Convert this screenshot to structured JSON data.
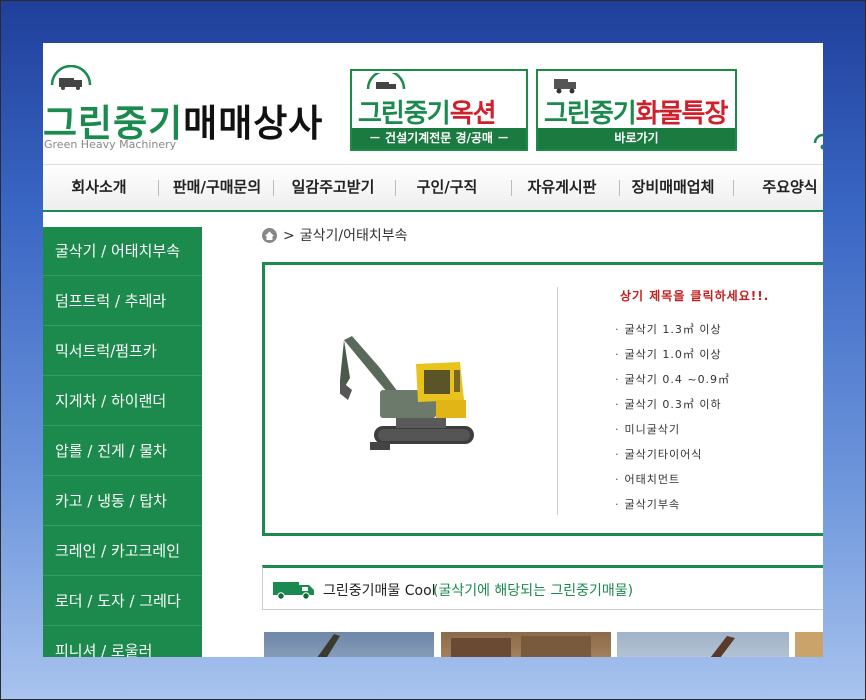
{
  "site": {
    "logo_part1": "그린중기",
    "logo_part2": "매매상사",
    "logo_subtitle": "Green Heavy Machinery"
  },
  "banners": {
    "auction": {
      "title_green": "그린중기",
      "title_red": "옥션",
      "bar_text": "－ 건설기계전문 경/공매 －"
    },
    "truck": {
      "title_green": "그린중기",
      "title_red": "화물특장",
      "bar_text": "바로가기"
    }
  },
  "nav": {
    "items": [
      "회사소개",
      "판매/구매문의",
      "일감주고받기",
      "구인/구직",
      "자유게시판",
      "장비매매업체",
      "주요양식"
    ]
  },
  "sidebar": {
    "items": [
      "굴삭기 / 어태치부속",
      "덤프트럭 / 추레라",
      "믹서트럭/펌프카",
      "지게차 / 하이랜더",
      "압롤 / 진게 / 물차",
      "카고 / 냉동 / 탑차",
      "크레인 / 카고크레인",
      "로더 / 도자 / 그레다",
      "피니셔 / 로울러"
    ]
  },
  "breadcrumb": {
    "current": "굴삭기/어태치부속"
  },
  "info": {
    "notice": "상기 제목을 클릭하세요!!.",
    "categories": [
      "굴삭기 1.3㎥ 이상",
      "굴삭기 1.0㎥ 이상",
      "굴삭기 0.4 ~0.9㎥",
      "굴삭기 0.3㎥ 이하",
      "미니굴삭기",
      "굴삭기타이어식",
      "어태치먼트",
      "굴삭기부속"
    ]
  },
  "listing": {
    "title": "그린중기매물  Cool",
    "subtitle": "(굴삭기에 해당되는 그린중기매물)"
  },
  "colors": {
    "brand_green": "#1d8a4d",
    "accent_red": "#d0202b"
  },
  "icons": [
    "truck-icon",
    "home-icon",
    "excavator-image"
  ]
}
